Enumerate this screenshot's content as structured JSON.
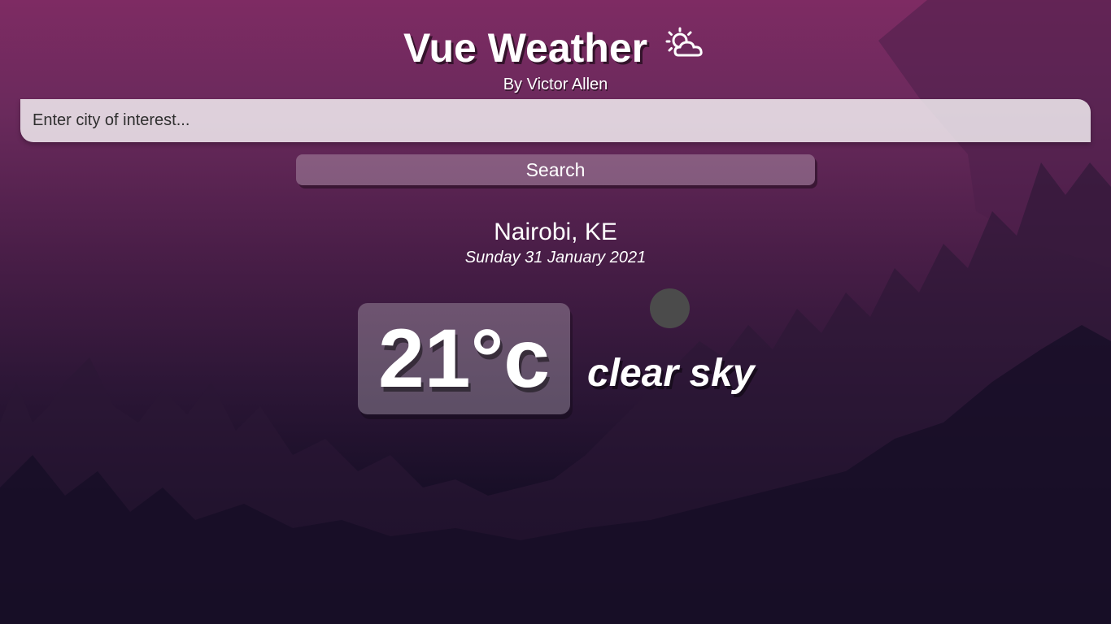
{
  "header": {
    "title": "Vue Weather",
    "title_icon": "sun-behind-cloud-icon",
    "byline": "By Victor Allen"
  },
  "search": {
    "placeholder": "Enter city of interest...",
    "value": "",
    "button_label": "Search"
  },
  "weather": {
    "location": "Nairobi, KE",
    "date": "Sunday 31 January 2021",
    "temperature": "21°c",
    "condition": "clear sky",
    "icon": "weather-condition-icon"
  },
  "colors": {
    "background_top": "#7e2b63",
    "background_bottom": "#0c0a1a",
    "text": "#ffffff",
    "icon_placeholder": "#4b4b4b"
  }
}
